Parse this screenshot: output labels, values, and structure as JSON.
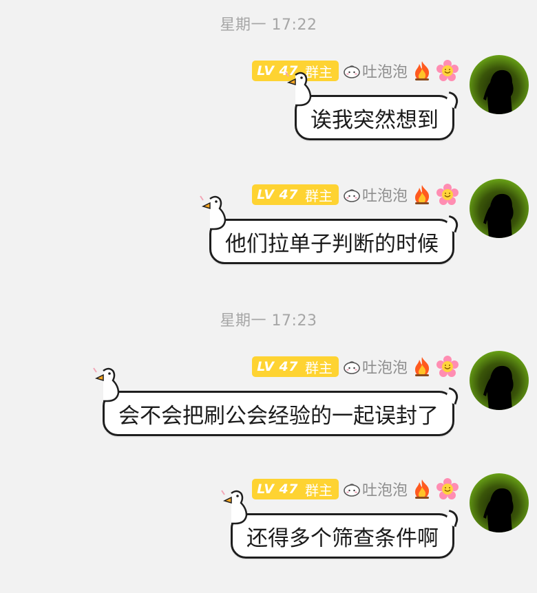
{
  "chat": {
    "timestamps": [
      "星期一 17:22",
      "星期一 17:23"
    ],
    "sender": {
      "level": "LV 47",
      "role": "群主",
      "nickname": "吐泡泡"
    },
    "messages": [
      "诶我突然想到",
      "他们拉单子判断的时候",
      "会不会把刷公会经验的一起误封了",
      "还得多个筛查条件啊"
    ]
  },
  "colors": {
    "background": "#f2f2f2",
    "level_badge": "#fed332",
    "timestamp_text": "#a6a6a6",
    "nickname_text": "#8e8e8e",
    "bubble_border": "#1e1e1e"
  },
  "icons": {
    "nickname_prefix": "bun-icon",
    "status_1": "fire-icon",
    "status_2": "flower-icon",
    "bubble_decoration": "goose-icon",
    "avatar": "avatar-silhouette"
  }
}
